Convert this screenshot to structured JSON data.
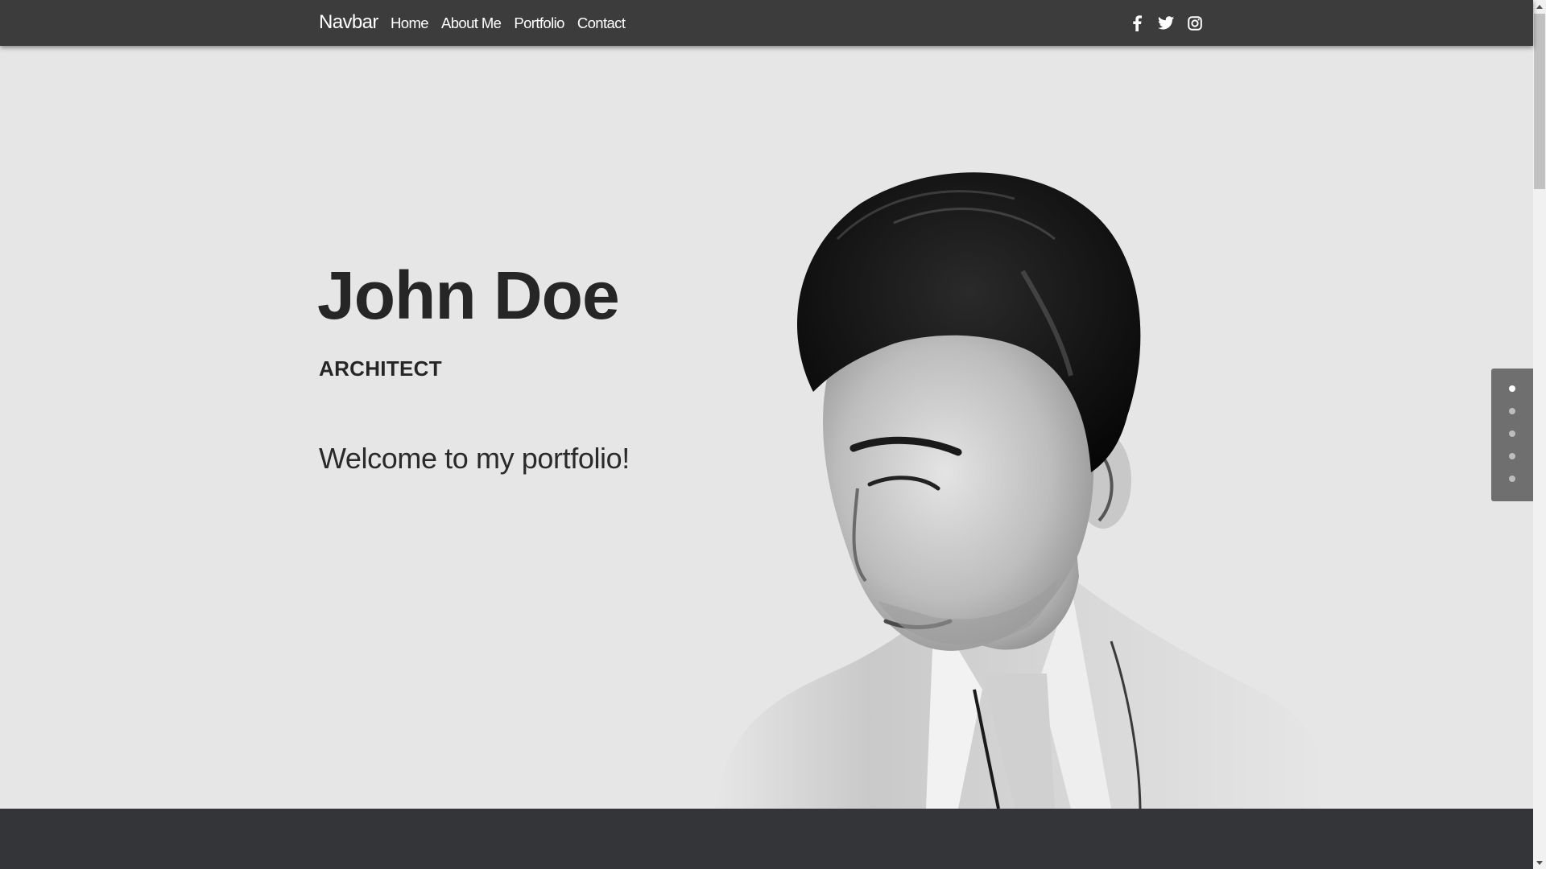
{
  "navbar": {
    "brand": "Navbar",
    "links": [
      "Home",
      "About Me",
      "Portfolio",
      "Contact"
    ],
    "social_icons": [
      "facebook-icon",
      "twitter-icon",
      "instagram-icon"
    ]
  },
  "hero": {
    "name": "John Doe",
    "role": "ARCHITECT",
    "welcome": "Welcome to my portfolio!",
    "portrait": "black-and-white portrait photo"
  },
  "section_nav": {
    "count": 5,
    "active_index": 0
  },
  "colors": {
    "navbar_bg": "#3c3c3c",
    "hero_bg": "#e6e6e6",
    "footer_bg": "#333538",
    "dots_panel_bg": "#6f6f6f",
    "text_dark": "#262626"
  }
}
